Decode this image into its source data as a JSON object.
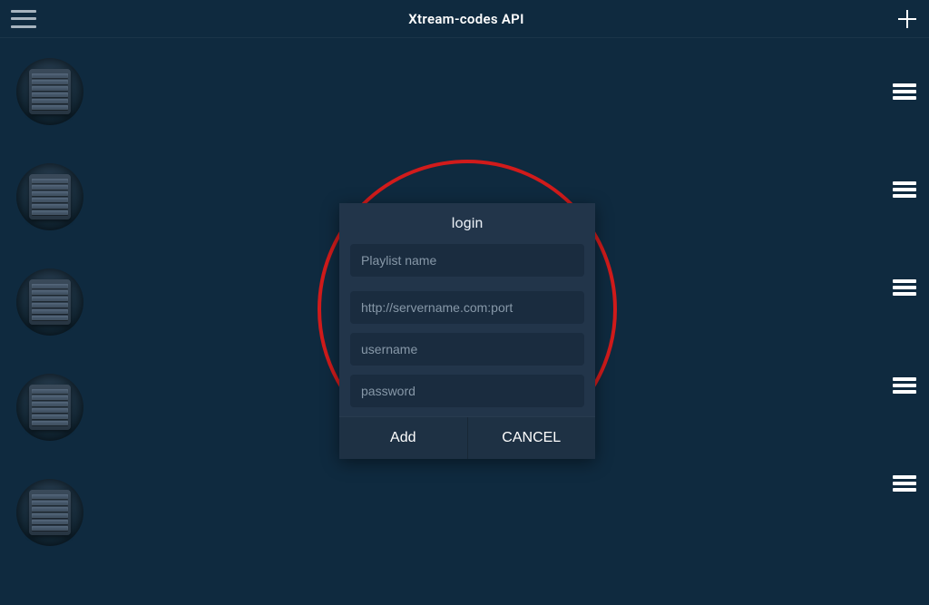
{
  "header": {
    "title": "Xtream-codes API"
  },
  "dialog": {
    "title": "login",
    "fields": {
      "playlist_placeholder": "Playlist name",
      "server_placeholder": "http://servername.com:port",
      "username_placeholder": "username",
      "password_placeholder": "password"
    },
    "actions": {
      "add": "Add",
      "cancel": "CANCEL"
    }
  },
  "servers": {
    "count": 5
  },
  "row_menus": {
    "count": 5
  },
  "annotation": {
    "type": "circle",
    "color": "#d11b1b"
  }
}
